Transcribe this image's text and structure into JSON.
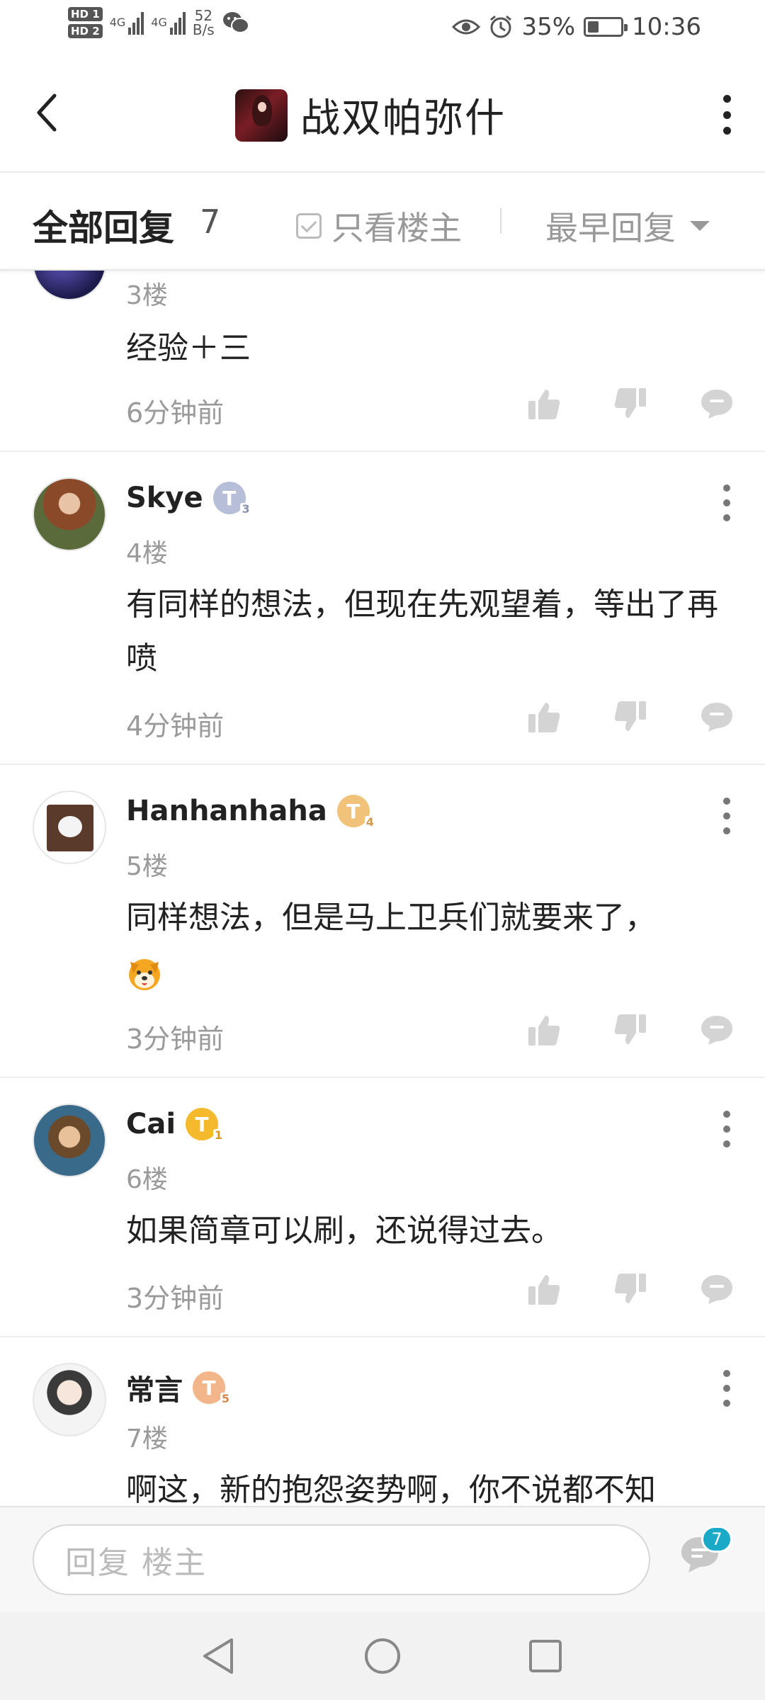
{
  "status_bar": {
    "hd1": "HD",
    "hd1_sub": "1",
    "hd2": "HD",
    "hd2_sub": "2",
    "net1": "4G",
    "net2": "4G",
    "speed_value": "52",
    "speed_unit": "B/s",
    "battery_percent": "35%",
    "battery_level": 0.35,
    "time": "10:36",
    "icons": [
      "hd-icon",
      "signal-icon",
      "wechat-icon",
      "eye-icon",
      "alarm-icon",
      "battery-icon"
    ]
  },
  "header": {
    "title": "战双帕弥什"
  },
  "filter": {
    "all_replies_label": "全部回复",
    "reply_count": "7",
    "op_only_label": "只看楼主",
    "sort_label": "最早回复"
  },
  "comments": [
    {
      "username": "",
      "badge": "",
      "floor": "3楼",
      "content": "经验＋三",
      "time": "6分钟前"
    },
    {
      "username": "Skye",
      "badge": "T",
      "badge_level": "3",
      "badge_color": "#b7bfd8",
      "floor": "4楼",
      "content": "有同样的想法，但现在先观望着，等出了再喷",
      "time": "4分钟前"
    },
    {
      "username": "Hanhanhaha",
      "badge": "T",
      "badge_level": "4",
      "badge_color": "#f0c27a",
      "floor": "5楼",
      "content": "同样想法，但是马上卫兵们就要来了，",
      "emoji": "dog-emoji",
      "time": "3分钟前"
    },
    {
      "username": "Cai",
      "badge": "T",
      "badge_level": "1",
      "badge_color": "#f5b92e",
      "floor": "6楼",
      "content": "如果简章可以刷，还说得过去。",
      "time": "3分钟前"
    },
    {
      "username": "常言",
      "badge": "T",
      "badge_level": "5",
      "badge_color": "#f3b68a",
      "floor": "7楼",
      "content": "啊这，新的抱怨姿势啊，你不说都不知"
    }
  ],
  "reply_bar": {
    "placeholder": "回复  楼主",
    "comment_count": "7"
  },
  "colors": {
    "accent": "#1aa9c7",
    "icon_gray": "#d4d4d4",
    "text_gray": "#9a9a9a"
  }
}
